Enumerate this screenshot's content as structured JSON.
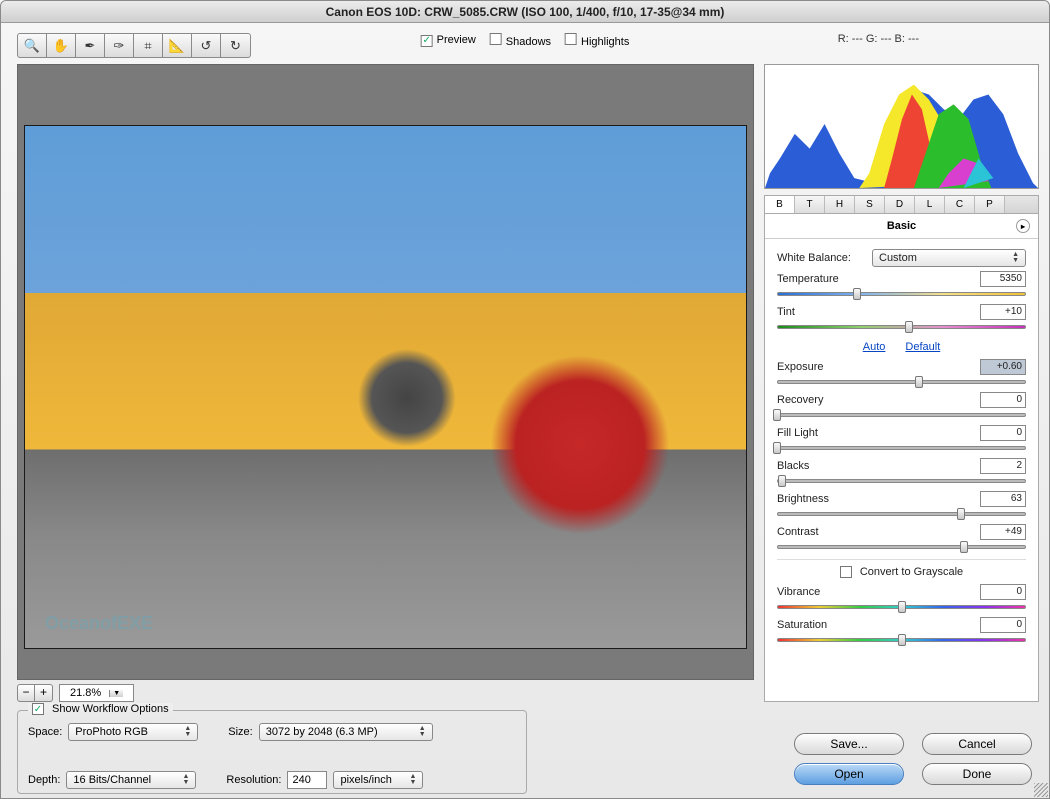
{
  "title": "Canon EOS 10D:  CRW_5085.CRW  (ISO 100, 1/400, f/10, 17-35@34 mm)",
  "checks": {
    "preview": "Preview",
    "shadows": "Shadows",
    "highlights": "Highlights"
  },
  "rgb": "R: ---   G: ---   B: ---",
  "zoom": "21.8%",
  "watermark": "OceanofEXE",
  "tabs": [
    "B",
    "T",
    "H",
    "S",
    "D",
    "L",
    "C",
    "P"
  ],
  "panel_title": "Basic",
  "wb": {
    "label": "White Balance:",
    "value": "Custom"
  },
  "sliders": {
    "temperature": {
      "label": "Temperature",
      "value": "5350",
      "pos": 32,
      "grad": "temp"
    },
    "tint": {
      "label": "Tint",
      "value": "+10",
      "pos": 53,
      "grad": "tint"
    },
    "exposure": {
      "label": "Exposure",
      "value": "+0.60",
      "pos": 57,
      "hl": true
    },
    "recovery": {
      "label": "Recovery",
      "value": "0",
      "pos": 0
    },
    "fill": {
      "label": "Fill Light",
      "value": "0",
      "pos": 0
    },
    "blacks": {
      "label": "Blacks",
      "value": "2",
      "pos": 2
    },
    "brightness": {
      "label": "Brightness",
      "value": "63",
      "pos": 74
    },
    "contrast": {
      "label": "Contrast",
      "value": "+49",
      "pos": 75
    },
    "vibrance": {
      "label": "Vibrance",
      "value": "0",
      "pos": 50,
      "grad": "rainbow"
    },
    "saturation": {
      "label": "Saturation",
      "value": "0",
      "pos": 50,
      "grad": "rainbow"
    }
  },
  "links": {
    "auto": "Auto",
    "default": "Default"
  },
  "grayscale": "Convert to Grayscale",
  "workflow": {
    "legend": "Show Workflow Options",
    "space_l": "Space:",
    "space_v": "ProPhoto RGB",
    "size_l": "Size:",
    "size_v": "3072 by 2048  (6.3 MP)",
    "depth_l": "Depth:",
    "depth_v": "16 Bits/Channel",
    "res_l": "Resolution:",
    "res_v": "240",
    "res_unit": "pixels/inch"
  },
  "buttons": {
    "save": "Save...",
    "cancel": "Cancel",
    "open": "Open",
    "done": "Done"
  }
}
